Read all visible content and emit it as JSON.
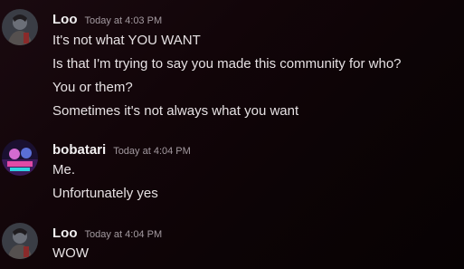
{
  "messages": [
    {
      "username": "Loo",
      "timestamp": "Today at 4:03 PM",
      "lines": [
        "It's not what YOU WANT",
        "Is that I'm trying to say you made this community for who?",
        "You or them?",
        "Sometimes it's not always what you want"
      ]
    },
    {
      "username": "bobatari",
      "timestamp": "Today at 4:04 PM",
      "lines": [
        "Me.",
        "Unfortunately yes"
      ]
    },
    {
      "username": "Loo",
      "timestamp": "Today at 4:04 PM",
      "lines": [
        "WOW"
      ]
    }
  ]
}
